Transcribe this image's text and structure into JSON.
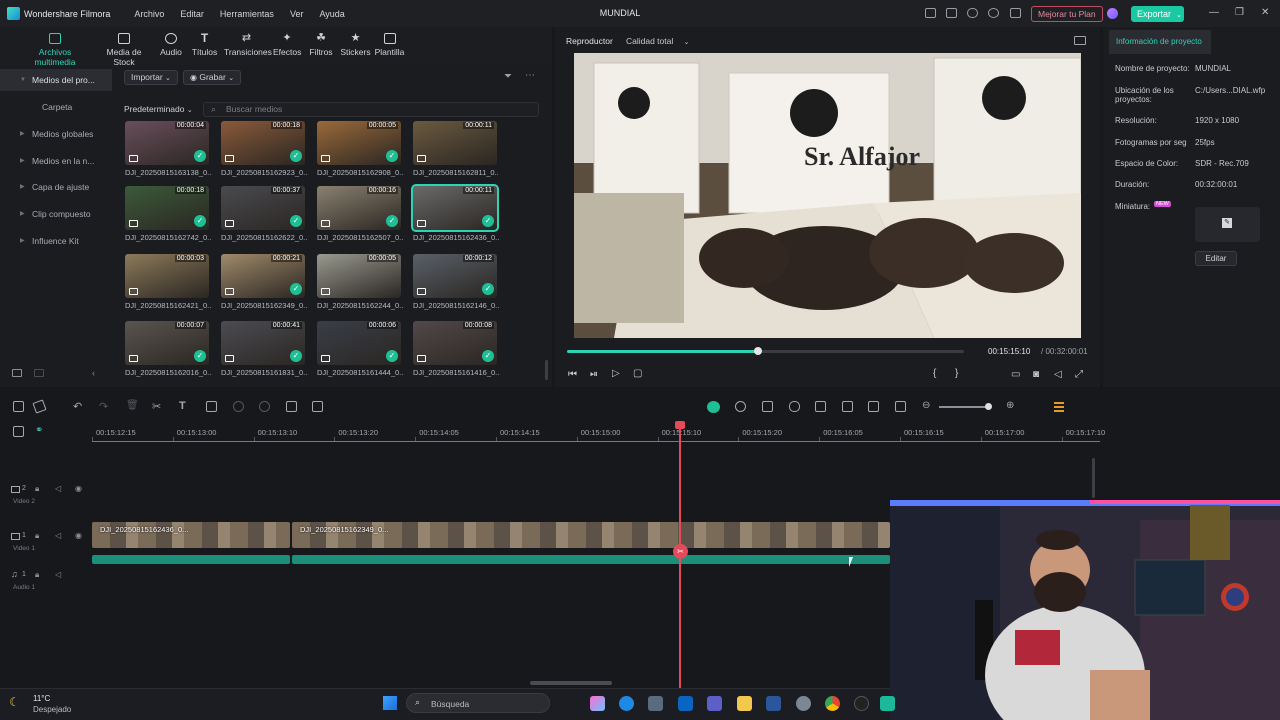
{
  "titlebar": {
    "app_name": "Wondershare Filmora",
    "menus": [
      "Archivo",
      "Editar",
      "Herramientas",
      "Ver",
      "Ayuda"
    ],
    "project_title": "MUNDIAL",
    "upgrade_label": "Mejorar tu Plan",
    "export_label": "Exportar"
  },
  "media_tabs": [
    {
      "label": "Archivos multimedia",
      "active": true
    },
    {
      "label": "Media de Stock"
    },
    {
      "label": "Audio"
    },
    {
      "label": "Títulos"
    },
    {
      "label": "Transiciones"
    },
    {
      "label": "Efectos"
    },
    {
      "label": "Filtros"
    },
    {
      "label": "Stickers"
    },
    {
      "label": "Plantilla"
    }
  ],
  "sidebar": {
    "items": [
      {
        "label": "Medios del proyecto",
        "display": "Medios del pro..."
      },
      {
        "label": "Carpeta"
      },
      {
        "label": "Medios globales"
      },
      {
        "label": "Medios en la nube",
        "display": "Medios en la n..."
      },
      {
        "label": "Capa de ajuste"
      },
      {
        "label": "Clip compuesto"
      },
      {
        "label": "Influence Kit"
      }
    ]
  },
  "media": {
    "import_label": "Importar",
    "record_label": "Grabar",
    "sort_label": "Predeterminado",
    "search_placeholder": "Buscar medios",
    "items": [
      {
        "name": "DJI_20250815163138_0...",
        "duration": "00:00:04",
        "checked": true
      },
      {
        "name": "DJI_20250815162923_0...",
        "duration": "00:00:18",
        "checked": true
      },
      {
        "name": "DJI_20250815162908_0...",
        "duration": "00:00:05",
        "checked": true
      },
      {
        "name": "DJI_20250815162811_0...",
        "duration": "00:00:11",
        "checked": false
      },
      {
        "name": "DJI_20250815162742_0...",
        "duration": "00:00:18",
        "checked": true
      },
      {
        "name": "DJI_20250815162622_0...",
        "duration": "00:00:37",
        "checked": true
      },
      {
        "name": "DJI_20250815162507_0...",
        "duration": "00:00:16",
        "checked": true
      },
      {
        "name": "DJI_20250815162436_0...",
        "duration": "00:00:11",
        "checked": true,
        "selected": true
      },
      {
        "name": "DJI_20250815162421_0...",
        "duration": "00:00:03",
        "checked": false
      },
      {
        "name": "DJI_20250815162349_0...",
        "duration": "00:00:21",
        "checked": true
      },
      {
        "name": "DJI_20250815162244_0...",
        "duration": "00:00:05",
        "checked": false
      },
      {
        "name": "DJI_20250815162146_0...",
        "duration": "00:00:12",
        "checked": true
      },
      {
        "name": "DJI_20250815162016_0...",
        "duration": "00:00:07",
        "checked": true
      },
      {
        "name": "DJI_20250815161831_0...",
        "duration": "00:00:41",
        "checked": true
      },
      {
        "name": "DJI_20250815161444_0...",
        "duration": "00:00:06",
        "checked": true
      },
      {
        "name": "DJI_20250815161416_0...",
        "duration": "00:00:08",
        "checked": true
      }
    ]
  },
  "player": {
    "tab_player": "Reproductor",
    "quality": "Calidad total",
    "current_time": "00:15:15:10",
    "total_time": "/ 00:32:00:01",
    "progress": 0.48,
    "preview_brand": "Sr. Alfajor"
  },
  "project_info": {
    "tab": "Información de proyecto",
    "fields": [
      {
        "label": "Nombre de proyecto:",
        "value": "MUNDIAL"
      },
      {
        "label": "Ubicación de los proyectos:",
        "value": "C:/Users...DIAL.wfp"
      },
      {
        "label": "Resolución:",
        "value": "1920 x 1080"
      },
      {
        "label": "Fotogramas por seg",
        "value": "25fps"
      },
      {
        "label": "Espacio de Color:",
        "value": "SDR - Rec.709"
      },
      {
        "label": "Duración:",
        "value": "00:32:00:01"
      }
    ],
    "thumbnail_label": "Miniatura:",
    "new_badge": "NEW",
    "edit_label": "Editar"
  },
  "timeline": {
    "ticks": [
      "00:15:12:15",
      "00:15:13:00",
      "00:15:13:10",
      "00:15:13:20",
      "00:15:14:05",
      "00:15:14:15",
      "00:15:15:00",
      "00:15:15:10",
      "00:15:15:20",
      "00:15:16:05",
      "00:15:16:15",
      "00:15:17:00",
      "00:15:17:10"
    ],
    "tracks": [
      {
        "num": "2",
        "name": "Video 2"
      },
      {
        "num": "1",
        "name": "Video 1"
      },
      {
        "num": "1",
        "name": "Audio 1"
      }
    ],
    "clips": [
      {
        "name": "DJI_20250815162436_0..."
      },
      {
        "name": "DJI_20250815162349_0..."
      }
    ]
  },
  "taskbar": {
    "temperature": "11°C",
    "weather": "Despejado",
    "search_placeholder": "Búsqueda"
  }
}
